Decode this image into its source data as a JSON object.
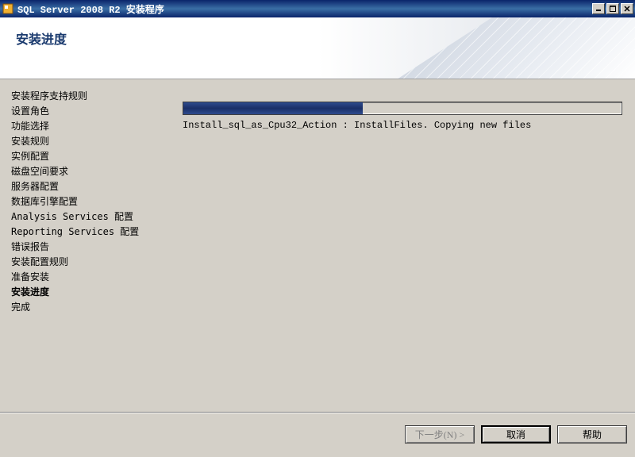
{
  "window": {
    "title": "SQL Server 2008 R2 安装程序"
  },
  "header": {
    "title": "安装进度"
  },
  "sidebar": {
    "items": [
      {
        "label": "安装程序支持规则",
        "current": false
      },
      {
        "label": "设置角色",
        "current": false
      },
      {
        "label": "功能选择",
        "current": false
      },
      {
        "label": "安装规则",
        "current": false
      },
      {
        "label": "实例配置",
        "current": false
      },
      {
        "label": "磁盘空间要求",
        "current": false
      },
      {
        "label": "服务器配置",
        "current": false
      },
      {
        "label": "数据库引擎配置",
        "current": false
      },
      {
        "label": "Analysis Services 配置",
        "current": false
      },
      {
        "label": "Reporting Services 配置",
        "current": false
      },
      {
        "label": "错误报告",
        "current": false
      },
      {
        "label": "安装配置规则",
        "current": false
      },
      {
        "label": "准备安装",
        "current": false
      },
      {
        "label": "安装进度",
        "current": true
      },
      {
        "label": "完成",
        "current": false
      }
    ]
  },
  "progress": {
    "percent": 41,
    "status": "Install_sql_as_Cpu32_Action : InstallFiles. Copying new files"
  },
  "footer": {
    "next": "下一步(N) >",
    "cancel": "取消",
    "help": "帮助"
  }
}
